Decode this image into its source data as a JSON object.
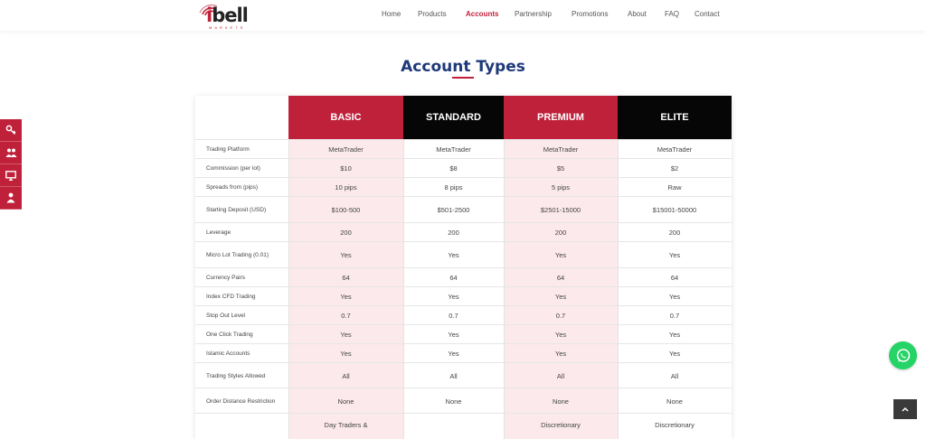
{
  "logo": {
    "text_i": "i",
    "text_rest": "bell",
    "sub": "MARKETS"
  },
  "nav": [
    {
      "label": "Home",
      "active": false
    },
    {
      "label": "Products",
      "active": false
    },
    {
      "label": "Accounts",
      "active": true
    },
    {
      "label": "Partnership",
      "active": false
    },
    {
      "label": "Promotions",
      "active": false
    },
    {
      "label": "About",
      "active": false
    },
    {
      "label": "FAQ",
      "active": false
    },
    {
      "label": "Contact",
      "active": false
    }
  ],
  "page_title": "Account Types",
  "side_icons": [
    "key-icon",
    "users-icon",
    "monitor-icon",
    "user-icon"
  ],
  "colors": {
    "accent": "#c0213a",
    "dark": "#060606",
    "title": "#1f3a7a",
    "tint": "#fbe9ec",
    "whatsapp": "#25d366"
  },
  "table": {
    "columns": [
      {
        "label": "BASIC",
        "style": "red"
      },
      {
        "label": "STANDARD",
        "style": "black"
      },
      {
        "label": "PREMIUM",
        "style": "red"
      },
      {
        "label": "ELITE",
        "style": "black"
      }
    ],
    "rows": [
      {
        "label": "Trading Platform",
        "values": [
          "MetaTrader",
          "MetaTrader",
          "MetaTrader",
          "MetaTrader"
        ]
      },
      {
        "label": "Commission (per lot)",
        "values": [
          "$10",
          "$8",
          "$5",
          "$2"
        ]
      },
      {
        "label": "Spreads from (pips)",
        "values": [
          "10 pips",
          "8 pips",
          "5 pips",
          "Raw"
        ]
      },
      {
        "label": "Starting Deposit (USD)",
        "values": [
          "$100-500",
          "$501-2500",
          "$2501-15000",
          "$15001-50000"
        ]
      },
      {
        "label": "Leverage",
        "values": [
          "200",
          "200",
          "200",
          "200"
        ]
      },
      {
        "label": "Micro Lot Trading (0.01)",
        "values": [
          "Yes",
          "Yes",
          "Yes",
          "Yes"
        ]
      },
      {
        "label": "Currency Pairs",
        "values": [
          "64",
          "64",
          "64",
          "64"
        ]
      },
      {
        "label": "Index CFD Trading",
        "values": [
          "Yes",
          "Yes",
          "Yes",
          "Yes"
        ]
      },
      {
        "label": "Stop Out Level",
        "values": [
          "0.7",
          "0.7",
          "0.7",
          "0.7"
        ]
      },
      {
        "label": "One Click Trading",
        "values": [
          "Yes",
          "Yes",
          "Yes",
          "Yes"
        ]
      },
      {
        "label": "Islamic Accounts",
        "values": [
          "Yes",
          "Yes",
          "Yes",
          "Yes"
        ]
      },
      {
        "label": "Trading Styles Allowed",
        "values": [
          "All",
          "All",
          "All",
          "All"
        ]
      },
      {
        "label": "Order Distance Restriction",
        "values": [
          "None",
          "None",
          "None",
          "None"
        ]
      },
      {
        "label": "",
        "values": [
          "Day Traders &",
          "",
          "Discretionary",
          "Discretionary"
        ]
      }
    ]
  }
}
